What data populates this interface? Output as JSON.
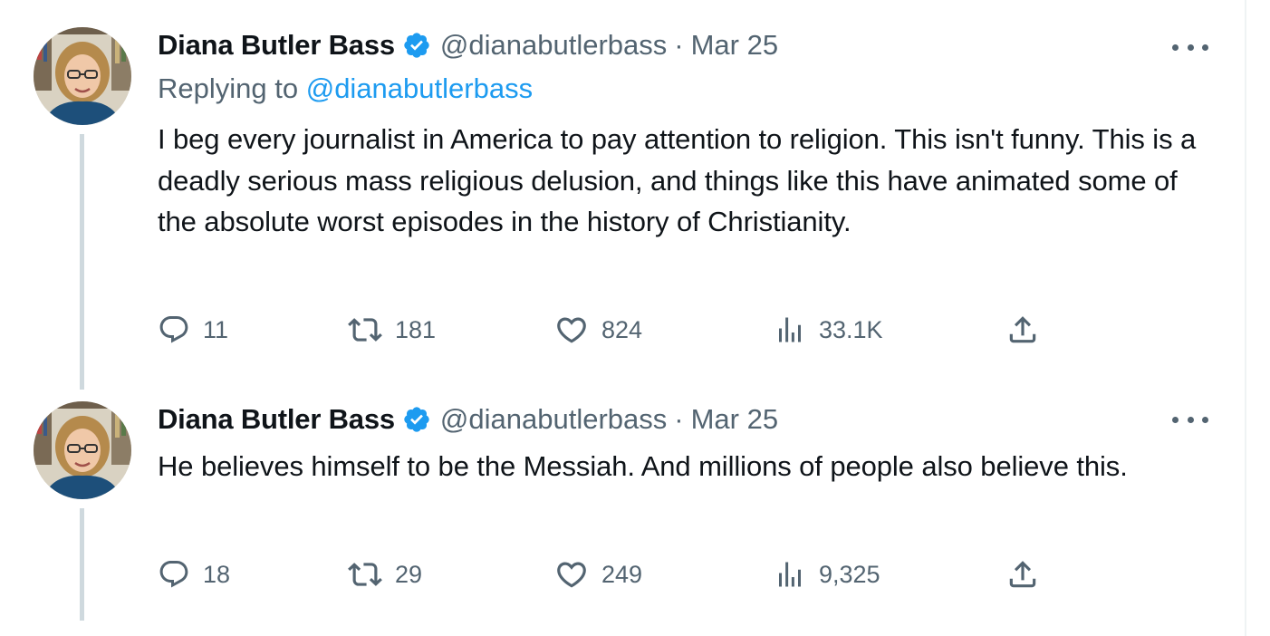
{
  "tweets": [
    {
      "display_name": "Diana Butler Bass",
      "handle": "@dianabutlerbass",
      "separator": "·",
      "date": "Mar 25",
      "replying_prefix": "Replying to",
      "replying_mention": "@dianabutlerbass",
      "text": "I beg every journalist in America to pay attention to religion. This isn't funny. This is a deadly serious mass religious delusion, and things like this have animated some of the absolute worst episodes in the history of Christianity.",
      "replies": "11",
      "reposts": "181",
      "likes": "824",
      "views": "33.1K"
    },
    {
      "display_name": "Diana Butler Bass",
      "handle": "@dianabutlerbass",
      "separator": "·",
      "date": "Mar 25",
      "text": "He believes himself to be the Messiah. And millions of people also believe this.",
      "replies": "18",
      "reposts": "29",
      "likes": "249",
      "views": "9,325"
    }
  ],
  "icons": {
    "verified": "verified-badge-icon",
    "more": "more-horizontal-icon",
    "reply": "reply-icon",
    "repost": "repost-icon",
    "like": "heart-icon",
    "views": "views-bar-chart-icon",
    "share": "share-icon"
  },
  "colors": {
    "text_primary": "#0f1419",
    "text_secondary": "#536471",
    "accent": "#1d9bf0",
    "thread_line": "#cfd9de"
  }
}
